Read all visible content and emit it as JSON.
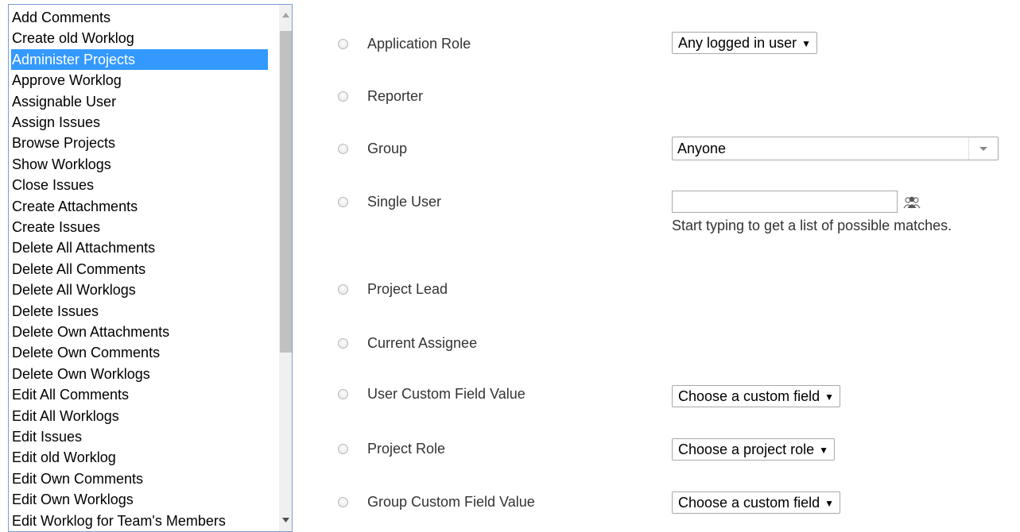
{
  "permissions": {
    "items": [
      "Add Comments",
      "Create old Worklog",
      "Administer Projects",
      "Approve Worklog",
      "Assignable User",
      "Assign Issues",
      "Browse Projects",
      "Show Worklogs",
      "Close Issues",
      "Create Attachments",
      "Create Issues",
      "Delete All Attachments",
      "Delete All Comments",
      "Delete All Worklogs",
      "Delete Issues",
      "Delete Own Attachments",
      "Delete Own Comments",
      "Delete Own Worklogs",
      "Edit All Comments",
      "Edit All Worklogs",
      "Edit Issues",
      "Edit old Worklog",
      "Edit Own Comments",
      "Edit Own Worklogs",
      "Edit Worklog for Team's Members"
    ],
    "selected_index": 2,
    "selection_color": "#3399ff"
  },
  "options": {
    "application_role": {
      "label": "Application Role",
      "select_value": "Any logged in user"
    },
    "reporter": {
      "label": "Reporter"
    },
    "group": {
      "label": "Group",
      "select_value": "Anyone"
    },
    "single_user": {
      "label": "Single User",
      "input_value": "",
      "hint": "Start typing to get a list of possible matches."
    },
    "project_lead": {
      "label": "Project Lead"
    },
    "current_assignee": {
      "label": "Current Assignee"
    },
    "user_custom_field": {
      "label": "User Custom Field Value",
      "select_value": "Choose a custom field"
    },
    "project_role": {
      "label": "Project Role",
      "select_value": "Choose a project role"
    },
    "group_custom_field": {
      "label": "Group Custom Field Value",
      "select_value": "Choose a custom field"
    }
  },
  "icons": {
    "select_arrow": "▼",
    "user_picker": "user-picker-icon"
  }
}
